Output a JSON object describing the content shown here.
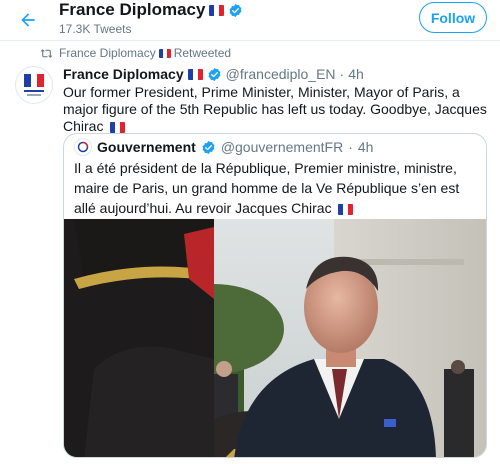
{
  "header": {
    "title": "France Diplomacy",
    "tweet_count": "17.3K Tweets",
    "follow_label": "Follow"
  },
  "retweet": {
    "by_name": "France Diplomacy",
    "label": "Retweeted"
  },
  "tweet": {
    "name": "France Diplomacy",
    "handle": "@francediplo_EN",
    "dot": "·",
    "time": "4h",
    "text": "Our former President, Prime Minister, Minister, Mayor of Paris, a major figure of the 5th Republic has left us today. Goodbye, Jacques Chirac"
  },
  "quoted_tweet": {
    "name": "Gouvernement",
    "handle": "@gouvernementFR",
    "dot": "·",
    "time": "4h",
    "text": "Il a été président de la République, Premier ministre, ministre, maire de Paris, un grand homme de la Ve République s’en est allé aujourd’hui. Au revoir Jacques Chirac"
  },
  "icons": {
    "back": "arrow-left-icon",
    "verified": "verified-badge-icon",
    "retweet": "retweet-icon",
    "flag": "french-flag-emoji"
  },
  "colors": {
    "accent": "#1da1f2",
    "text": "#14171a",
    "muted": "#657786",
    "border": "#e6ecf0"
  }
}
